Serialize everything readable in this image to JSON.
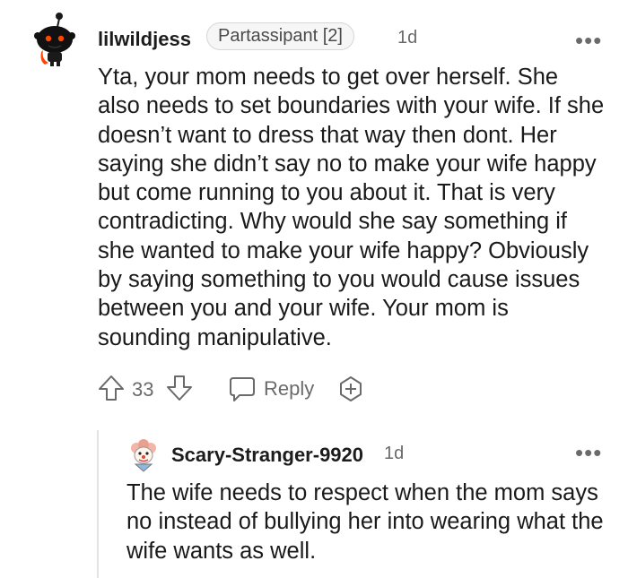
{
  "comment": {
    "username": "lilwildjess",
    "flair": "Partassipant [2]",
    "time": "1d",
    "more_label": "•••",
    "body": "Yta, your mom needs to get over herself. She also needs to set boundaries with your wife. If she doesn’t want to dress that way then dont. Her saying she didn’t say no to make your wife happy but come running to you about it. That is very contradicting. Why would she say something if she wanted to make your wife happy? Obviously by saying something to you would cause issues between you and your wife. Your mom is sounding manipulative.",
    "vote_count": "33",
    "reply_label": "Reply"
  },
  "reply": {
    "username": "Scary-Stranger-9920",
    "time": "1d",
    "more_label": "•••",
    "body": "The wife needs to respect when the mom says no instead of bullying her into wearing what the wife wants as well."
  },
  "icons": [
    "snoo-avatar-icon",
    "upvote-icon",
    "downvote-icon",
    "reply-icon",
    "award-icon",
    "clown-avatar-icon"
  ]
}
